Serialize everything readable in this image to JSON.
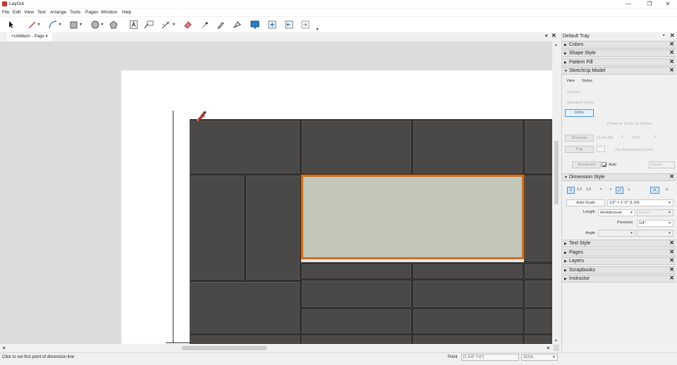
{
  "app": {
    "title": "LayOut"
  },
  "window_controls": {
    "minimize": "—",
    "maximize": "❐",
    "close": "✕"
  },
  "menu": [
    "File",
    "Edit",
    "View",
    "Text",
    "Arrange",
    "Tools",
    "Pages",
    "Window",
    "Help"
  ],
  "toolbar": {
    "tools": [
      "select-arrow",
      "line-pencil",
      "arc",
      "rectangle",
      "circle",
      "polygon",
      "text",
      "label",
      "dimension",
      "eraser",
      "style-eyedropper",
      "split",
      "join",
      "presentation",
      "add-page",
      "previous-page",
      "next-page"
    ]
  },
  "document_tab": {
    "label": "<Untitled> - Page 4",
    "pin": "▾",
    "close": "✕"
  },
  "status": {
    "message": "Click to set first point of dimension line",
    "point_label": "Point",
    "point_value": "[1 3-8\"  7-0\"]",
    "zoom": "151%"
  },
  "tray": {
    "title": "Default Tray",
    "pin": "▪",
    "close": "✕",
    "panels": {
      "colors": "Colors",
      "shape_style": "Shape Style",
      "pattern_fill": "Pattern Fill",
      "sketchup_model": "SketchUp Model",
      "dimension_style": "Dimension Style",
      "text_style": "Text Style",
      "pages": "Pages",
      "layers": "Layers",
      "scrapbooks": "Scrapbooks",
      "instructor": "Instructor"
    },
    "sketchup_model": {
      "tabs": [
        "View",
        "Styles"
      ],
      "scenes_label": "Scenes",
      "standard_views_label": "Standard Views",
      "ortho_button": "Ortho",
      "preserve_scale": "Preserve Scale on Resize",
      "shadows_button": "Shadows",
      "shadow_time": "11:44 AM",
      "shadow_date": "9/28",
      "fog_button": "Fog",
      "use_bg_color": "Use Background Color",
      "rendered_button": "Rendered",
      "auto_label": "Auto",
      "auto_checked": true,
      "raster_value": "Raster"
    },
    "dimension_style": {
      "auto_scale_button": "Auto Scale",
      "scale_value": "1/2\" = 1'-0\" (1:24)",
      "length_label": "Length",
      "length_value": "Architectural",
      "units_value": "Inches",
      "precision_label": "Precision",
      "precision_value": "1/4\"",
      "angle_label": "Angle",
      "align_buttons": [
        "1.2",
        "1.2",
        "1.2"
      ]
    }
  },
  "colors": {
    "cabinet": "#4a4947",
    "glass": "#c3c7b9",
    "glass_frame": "#c8722a",
    "app_icon": "#c8322d",
    "selection": "#4d94d8"
  }
}
